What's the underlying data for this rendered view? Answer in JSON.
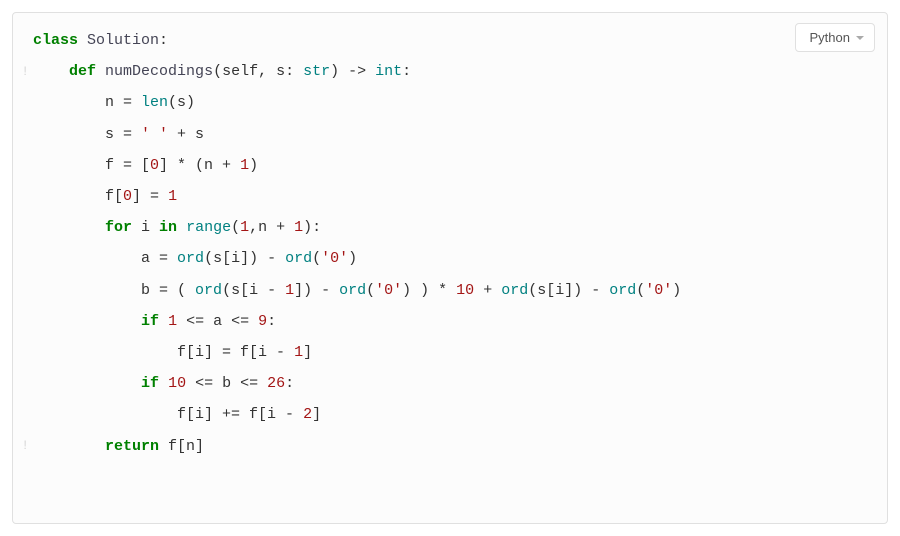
{
  "language_selector": {
    "label": "Python"
  },
  "gutter_glyphs": [
    "",
    "!",
    "",
    "",
    "",
    "",
    "",
    "",
    "",
    "",
    "",
    "",
    "",
    "!",
    "",
    ""
  ],
  "code": {
    "tokens": [
      {
        "t": "class",
        "c": "kw"
      },
      {
        "t": " ",
        "c": "op"
      },
      {
        "t": "Solution",
        "c": "cls"
      },
      {
        "t": ":",
        "c": "op"
      },
      {
        "t": "\n",
        "c": "op"
      },
      {
        "t": "    ",
        "c": "op"
      },
      {
        "t": "def",
        "c": "kw"
      },
      {
        "t": " ",
        "c": "op"
      },
      {
        "t": "numDecodings",
        "c": "fn"
      },
      {
        "t": "(",
        "c": "op"
      },
      {
        "t": "self",
        "c": "id"
      },
      {
        "t": ", s: ",
        "c": "op"
      },
      {
        "t": "str",
        "c": "bi"
      },
      {
        "t": ") -> ",
        "c": "op"
      },
      {
        "t": "int",
        "c": "bi"
      },
      {
        "t": ":",
        "c": "op"
      },
      {
        "t": "\n",
        "c": "op"
      },
      {
        "t": "        n = ",
        "c": "op"
      },
      {
        "t": "len",
        "c": "bi"
      },
      {
        "t": "(s)",
        "c": "op"
      },
      {
        "t": "\n",
        "c": "op"
      },
      {
        "t": "        s = ",
        "c": "op"
      },
      {
        "t": "' '",
        "c": "str"
      },
      {
        "t": " + s",
        "c": "op"
      },
      {
        "t": "\n",
        "c": "op"
      },
      {
        "t": "        f = [",
        "c": "op"
      },
      {
        "t": "0",
        "c": "num"
      },
      {
        "t": "] * (n + ",
        "c": "op"
      },
      {
        "t": "1",
        "c": "num"
      },
      {
        "t": ")",
        "c": "op"
      },
      {
        "t": "\n",
        "c": "op"
      },
      {
        "t": "        f[",
        "c": "op"
      },
      {
        "t": "0",
        "c": "num"
      },
      {
        "t": "] = ",
        "c": "op"
      },
      {
        "t": "1",
        "c": "num"
      },
      {
        "t": "\n",
        "c": "op"
      },
      {
        "t": "        ",
        "c": "op"
      },
      {
        "t": "for",
        "c": "kw"
      },
      {
        "t": " i ",
        "c": "op"
      },
      {
        "t": "in",
        "c": "kw"
      },
      {
        "t": " ",
        "c": "op"
      },
      {
        "t": "range",
        "c": "bi"
      },
      {
        "t": "(",
        "c": "op"
      },
      {
        "t": "1",
        "c": "num"
      },
      {
        "t": ",n + ",
        "c": "op"
      },
      {
        "t": "1",
        "c": "num"
      },
      {
        "t": "):",
        "c": "op"
      },
      {
        "t": "\n",
        "c": "op"
      },
      {
        "t": "            a = ",
        "c": "op"
      },
      {
        "t": "ord",
        "c": "bi"
      },
      {
        "t": "(s[i]) - ",
        "c": "op"
      },
      {
        "t": "ord",
        "c": "bi"
      },
      {
        "t": "(",
        "c": "op"
      },
      {
        "t": "'0'",
        "c": "str"
      },
      {
        "t": ")",
        "c": "op"
      },
      {
        "t": "\n",
        "c": "op"
      },
      {
        "t": "            b = ( ",
        "c": "op"
      },
      {
        "t": "ord",
        "c": "bi"
      },
      {
        "t": "(s[i - ",
        "c": "op"
      },
      {
        "t": "1",
        "c": "num"
      },
      {
        "t": "]) - ",
        "c": "op"
      },
      {
        "t": "ord",
        "c": "bi"
      },
      {
        "t": "(",
        "c": "op"
      },
      {
        "t": "'0'",
        "c": "str"
      },
      {
        "t": ") ) * ",
        "c": "op"
      },
      {
        "t": "10",
        "c": "num"
      },
      {
        "t": " + ",
        "c": "op"
      },
      {
        "t": "ord",
        "c": "bi"
      },
      {
        "t": "(s[i]) - ",
        "c": "op"
      },
      {
        "t": "ord",
        "c": "bi"
      },
      {
        "t": "(",
        "c": "op"
      },
      {
        "t": "'0'",
        "c": "str"
      },
      {
        "t": ")",
        "c": "op"
      },
      {
        "t": "\n",
        "c": "op"
      },
      {
        "t": "            ",
        "c": "op"
      },
      {
        "t": "if",
        "c": "kw"
      },
      {
        "t": " ",
        "c": "op"
      },
      {
        "t": "1",
        "c": "num"
      },
      {
        "t": " <= a <= ",
        "c": "op"
      },
      {
        "t": "9",
        "c": "num"
      },
      {
        "t": ":",
        "c": "op"
      },
      {
        "t": "\n",
        "c": "op"
      },
      {
        "t": "                f[i] = f[i - ",
        "c": "op"
      },
      {
        "t": "1",
        "c": "num"
      },
      {
        "t": "]",
        "c": "op"
      },
      {
        "t": "\n",
        "c": "op"
      },
      {
        "t": "            ",
        "c": "op"
      },
      {
        "t": "if",
        "c": "kw"
      },
      {
        "t": " ",
        "c": "op"
      },
      {
        "t": "10",
        "c": "num"
      },
      {
        "t": " <= b <= ",
        "c": "op"
      },
      {
        "t": "26",
        "c": "num"
      },
      {
        "t": ":",
        "c": "op"
      },
      {
        "t": "\n",
        "c": "op"
      },
      {
        "t": "                f[i] += f[i - ",
        "c": "op"
      },
      {
        "t": "2",
        "c": "num"
      },
      {
        "t": "]",
        "c": "op"
      },
      {
        "t": "\n",
        "c": "op"
      },
      {
        "t": "        ",
        "c": "op"
      },
      {
        "t": "return",
        "c": "kw"
      },
      {
        "t": " f[n]",
        "c": "op"
      }
    ]
  }
}
